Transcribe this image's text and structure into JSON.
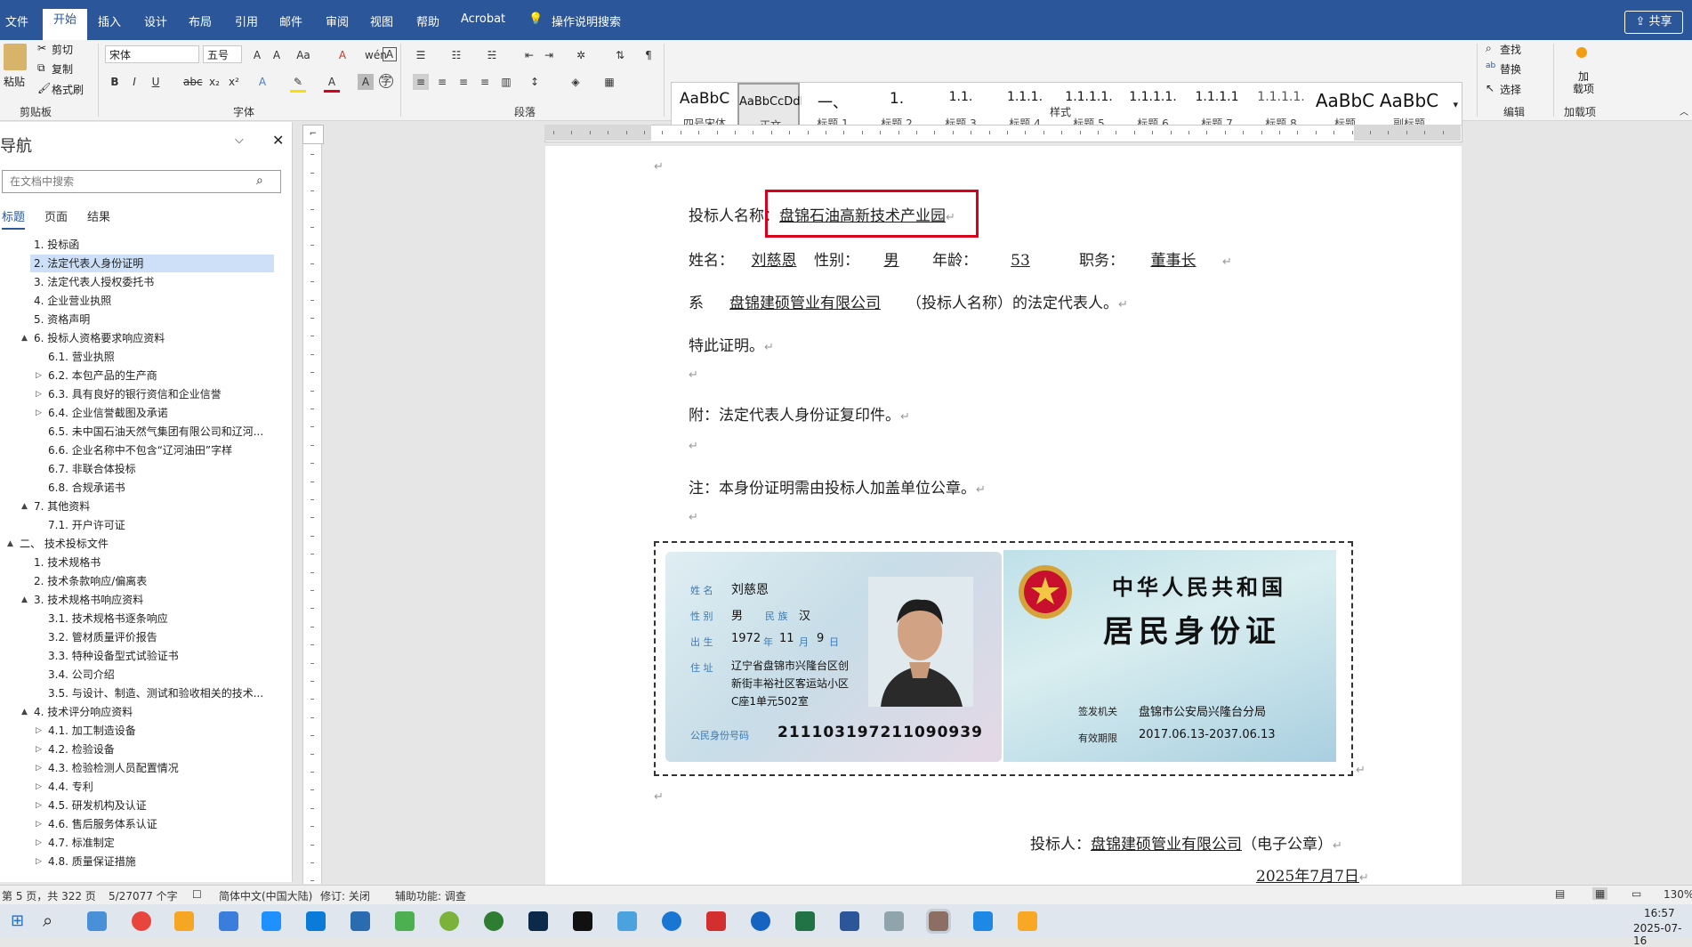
{
  "menubar": {
    "items": [
      "文件",
      "开始",
      "插入",
      "设计",
      "布局",
      "引用",
      "邮件",
      "审阅",
      "视图",
      "帮助",
      "Acrobat",
      "操作说明搜索"
    ],
    "share": "共享"
  },
  "ribbon": {
    "clipboard": {
      "paste": "粘贴",
      "cut": "剪切",
      "copy": "复制",
      "format_painter": "格式刷",
      "label": "剪贴板"
    },
    "font": {
      "family": "宋体",
      "size": "五号",
      "label": "字体"
    },
    "paragraph": {
      "label": "段落"
    },
    "styles": {
      "label": "样式",
      "tiles": [
        {
          "preview": "AaBbC",
          "name": "四号宋体"
        },
        {
          "preview": "AaBbCcDdI",
          "name": "正文"
        },
        {
          "preview": "一、",
          "name": "标题 1"
        },
        {
          "preview": "1.",
          "name": "标题 2"
        },
        {
          "preview": "1.1.",
          "name": "标题 3"
        },
        {
          "preview": "1.1.1.",
          "name": "标题 4"
        },
        {
          "preview": "1.1.1.1.",
          "name": "标题 5"
        },
        {
          "preview": "1.1.1.1.",
          "name": "标题 6"
        },
        {
          "preview": "1.1.1.1",
          "name": "标题 7"
        },
        {
          "preview": "1.1.1.1.",
          "name": "标题 8"
        },
        {
          "preview": "AaBbC",
          "name": "标题"
        },
        {
          "preview": "AaBbC",
          "name": "副标题"
        }
      ]
    },
    "editing": {
      "find": "查找",
      "replace": "替换",
      "select": "选择",
      "label": "编辑"
    },
    "addins": {
      "load": "加\n载项",
      "label": "加载项"
    }
  },
  "nav": {
    "title": "导航",
    "search_placeholder": "在文档中搜索",
    "tabs": [
      "标题",
      "页面",
      "结果"
    ],
    "items": [
      {
        "label": "1. 投标函",
        "level": 2,
        "caret": ""
      },
      {
        "label": "2. 法定代表人身份证明",
        "level": 2,
        "caret": "",
        "selected": true
      },
      {
        "label": "3. 法定代表人授权委托书",
        "level": 2,
        "caret": ""
      },
      {
        "label": "4. 企业营业执照",
        "level": 2,
        "caret": ""
      },
      {
        "label": "5. 资格声明",
        "level": 2,
        "caret": ""
      },
      {
        "label": "6. 投标人资格要求响应资料",
        "level": 2,
        "caret": "▲"
      },
      {
        "label": "6.1. 营业执照",
        "level": 3,
        "caret": ""
      },
      {
        "label": "6.2. 本包产品的生产商",
        "level": 3,
        "caret": "▷"
      },
      {
        "label": "6.3. 具有良好的银行资信和企业信誉",
        "level": 3,
        "caret": "▷"
      },
      {
        "label": "6.4. 企业信誉截图及承诺",
        "level": 3,
        "caret": "▷"
      },
      {
        "label": "6.5. 未中国石油天然气集团有限公司和辽河...",
        "level": 3,
        "caret": ""
      },
      {
        "label": "6.6. 企业名称中不包含“辽河油田”字样",
        "level": 3,
        "caret": ""
      },
      {
        "label": "6.7. 非联合体投标",
        "level": 3,
        "caret": ""
      },
      {
        "label": "6.8. 合规承诺书",
        "level": 3,
        "caret": ""
      },
      {
        "label": "7. 其他资料",
        "level": 2,
        "caret": "▲"
      },
      {
        "label": "7.1. 开户许可证",
        "level": 3,
        "caret": ""
      },
      {
        "label": "二、 技术投标文件",
        "level": 1,
        "caret": "▲"
      },
      {
        "label": "1. 技术规格书",
        "level": 2,
        "caret": ""
      },
      {
        "label": "2. 技术条款响应/偏离表",
        "level": 2,
        "caret": ""
      },
      {
        "label": "3. 技术规格书响应资料",
        "level": 2,
        "caret": "▲"
      },
      {
        "label": "3.1. 技术规格书逐条响应",
        "level": 3,
        "caret": ""
      },
      {
        "label": "3.2. 管材质量评价报告",
        "level": 3,
        "caret": ""
      },
      {
        "label": "3.3. 特种设备型式试验证书",
        "level": 3,
        "caret": ""
      },
      {
        "label": "3.4. 公司介绍",
        "level": 3,
        "caret": ""
      },
      {
        "label": "3.5. 与设计、制造、测试和验收相关的技术...",
        "level": 3,
        "caret": ""
      },
      {
        "label": "4. 技术评分响应资料",
        "level": 2,
        "caret": "▲"
      },
      {
        "label": "4.1. 加工制造设备",
        "level": 3,
        "caret": "▷"
      },
      {
        "label": "4.2. 检验设备",
        "level": 3,
        "caret": "▷"
      },
      {
        "label": "4.3. 检验检测人员配置情况",
        "level": 3,
        "caret": "▷"
      },
      {
        "label": "4.4. 专利",
        "level": 3,
        "caret": "▷"
      },
      {
        "label": "4.5. 研发机构及认证",
        "level": 3,
        "caret": "▷"
      },
      {
        "label": "4.6. 售后服务体系认证",
        "level": 3,
        "caret": "▷"
      },
      {
        "label": "4.7. 标准制定",
        "level": 3,
        "caret": "▷"
      },
      {
        "label": "4.8. 质量保证措施",
        "level": 3,
        "caret": "▷"
      }
    ]
  },
  "doc": {
    "bidder_label": "投标人名称：",
    "bidder_name": "盘锦石油高新技术产业园",
    "name_label": "姓名：",
    "name_value": "刘慈恩",
    "gender_label": "性别：",
    "gender_value": "男",
    "age_label": "年龄：",
    "age_value": "53",
    "title_label": "职务：",
    "title_value": "董事长",
    "line3_prefix": "系",
    "line3_company": "盘锦建硕管业有限公司",
    "line3_suffix": "（投标人名称）的法定代表人。",
    "line4": "特此证明。",
    "line5": "附：法定代表人身份证复印件。",
    "line6": "注：本身份证明需由投标人加盖单位公章。",
    "sign_label": "投标人：",
    "sign_company": "盘锦建硕管业有限公司",
    "sign_suffix": "（电子公章）",
    "date": "2025年7月7日"
  },
  "idcard": {
    "front": {
      "name_label": "姓 名",
      "name": "刘慈恩",
      "gender_label": "性 别",
      "gender": "男",
      "ethnic_label": "民 族",
      "ethnic": "汉",
      "birth_label": "出 生",
      "birth_y": "1972",
      "y": "年",
      "birth_m": "11",
      "m": "月",
      "birth_d": "9",
      "d": "日",
      "addr_label": "住 址",
      "addr1": "辽宁省盘锦市兴隆台区创",
      "addr2": "新街丰裕社区客运站小区",
      "addr3": "C座1单元502室",
      "id_label": "公民身份号码",
      "id": "211103197211090939"
    },
    "back": {
      "line1": "中华人民共和国",
      "line2": "居民身份证",
      "issuer_label": "签发机关",
      "issuer": "盘锦市公安局兴隆台分局",
      "valid_label": "有效期限",
      "valid": "2017.06.13-2037.06.13"
    }
  },
  "status": {
    "page": "第 5 页，共 322 页",
    "words": "5/27077 个字",
    "lang": "简体中文(中国大陆)",
    "track": "修订: 关闭",
    "access": "辅助功能: 调查",
    "zoom": "130%"
  },
  "taskbar": {
    "time": "16:57",
    "date": "2025-07-16"
  }
}
